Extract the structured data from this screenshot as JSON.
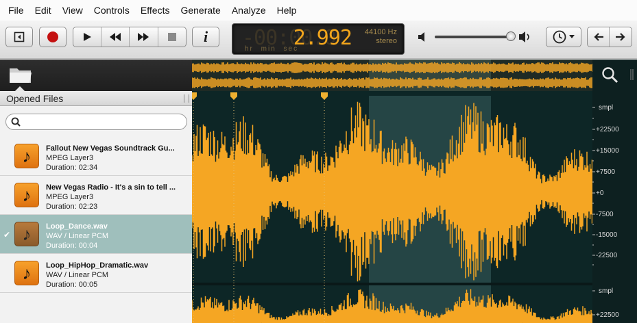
{
  "menu": [
    "File",
    "Edit",
    "View",
    "Controls",
    "Effects",
    "Generate",
    "Analyze",
    "Help"
  ],
  "toolbar": {
    "info_label": "i",
    "lcd_ghost": "-00:00:0",
    "lcd_time": "2.992",
    "lcd_rate": "44100 Hz",
    "lcd_channels": "stereo",
    "lcd_units": "hr min sec"
  },
  "sidebar": {
    "panel_title": "Opened Files",
    "files": [
      {
        "name": "Fallout  New Vegas Soundtrack  Gu...",
        "format": "MPEG Layer3",
        "duration": "Duration: 02:34",
        "selected": false
      },
      {
        "name": "New Vegas Radio - It's a sin to tell ...",
        "format": "MPEG Layer3",
        "duration": "Duration: 02:23",
        "selected": false
      },
      {
        "name": "Loop_Dance.wav",
        "format": "WAV / Linear PCM",
        "duration": "Duration: 00:04",
        "selected": true
      },
      {
        "name": "Loop_HipHop_Dramatic.wav",
        "format": "WAV / Linear PCM",
        "duration": "Duration: 00:05",
        "selected": false
      }
    ]
  },
  "scale": {
    "unit": "smpl",
    "ticks": [
      "+22500",
      "+15000",
      "+7500",
      "+0",
      "-7500",
      "-15000",
      "-22500"
    ],
    "unit2": "smpl",
    "tick2": "+22500"
  },
  "colors": {
    "waveform": "#f5a623",
    "selection": "#3a5f5f",
    "background": "#0d2626"
  }
}
